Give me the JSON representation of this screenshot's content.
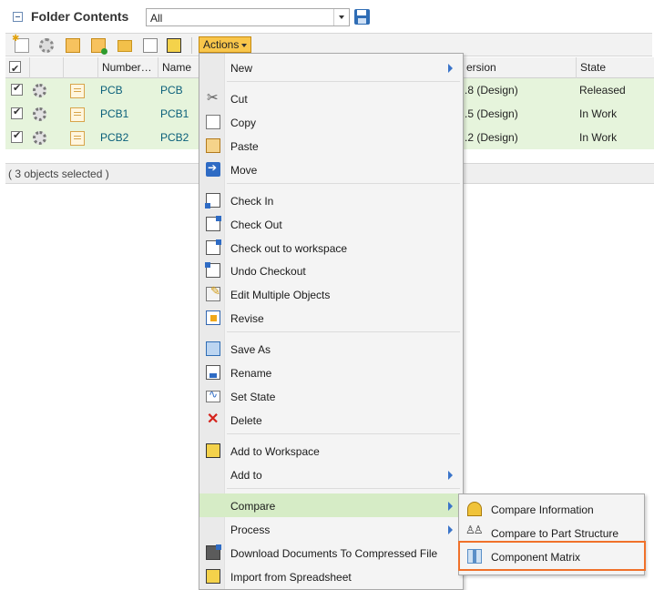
{
  "header": {
    "title": "Folder Contents",
    "view_value": "All"
  },
  "toolbar": {
    "icons": [
      "new-document-icon",
      "settings-gear-icon",
      "part-structure-icon",
      "part-checked-icon",
      "new-folder-icon",
      "copy-icon",
      "add-to-workspace-icon"
    ],
    "actions_label": "Actions"
  },
  "table": {
    "headers": {
      "number": "Number…",
      "name": "Name",
      "version": "ersion",
      "state": "State"
    },
    "rows": [
      {
        "number": "PCB",
        "name": "PCB",
        "version": ".8 (Design)",
        "state": "Released"
      },
      {
        "number": "PCB1",
        "name": "PCB1",
        "version": ".5 (Design)",
        "state": "In Work"
      },
      {
        "number": "PCB2",
        "name": "PCB2",
        "version": ".2 (Design)",
        "state": "In Work"
      }
    ],
    "footer": "( 3 objects selected )"
  },
  "menu": {
    "items": {
      "new": "New",
      "cut": "Cut",
      "copy": "Copy",
      "paste": "Paste",
      "move": "Move",
      "check_in": "Check In",
      "check_out": "Check Out",
      "check_out_ws": "Check out to workspace",
      "undo_checkout": "Undo Checkout",
      "edit_multiple": "Edit Multiple Objects",
      "revise": "Revise",
      "save_as": "Save As",
      "rename": "Rename",
      "set_state": "Set State",
      "delete": "Delete",
      "add_ws": "Add to Workspace",
      "add_to": "Add to",
      "compare": "Compare",
      "process": "Process",
      "download": "Download Documents To Compressed File",
      "import": "Import from Spreadsheet"
    }
  },
  "submenu": {
    "compare_information": "Compare Information",
    "compare_part_structure": "Compare to Part Structure",
    "component_matrix": "Component Matrix"
  },
  "colors": {
    "selected_row": "#e6f4dc",
    "menu_hover": "#d6ecc6",
    "actions_button": "#f9c64b",
    "link": "#0a5f7a",
    "highlight_outline": "#f0712a"
  }
}
